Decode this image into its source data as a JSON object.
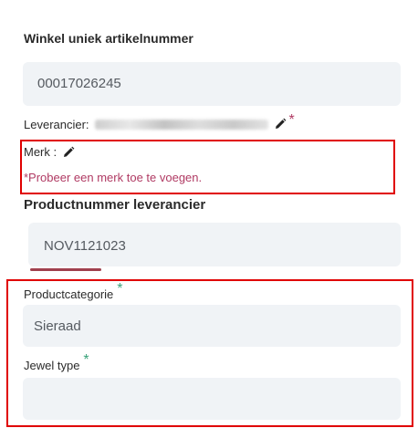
{
  "form": {
    "sku_title": "Winkel uniek artikelnummer",
    "sku_value": "00017026245",
    "supplier_label": "Leverancier:",
    "required_mark": "*",
    "brand_label": "Merk :",
    "brand_warning": "*Probeer een merk toe te voegen.",
    "supplier_number_title": "Productnummer leverancier",
    "supplier_number_value": "NOV1121023",
    "category_label": "Productcategorie",
    "category_value": "Sieraad",
    "jewel_type_label": "Jewel type",
    "jewel_type_value": ""
  },
  "colors": {
    "required_pink": "#b03a63",
    "required_green": "#3aa37a",
    "highlight_red": "#e00000",
    "field_bg": "#f0f3f6"
  },
  "icons": {
    "edit": "pencil-icon"
  }
}
